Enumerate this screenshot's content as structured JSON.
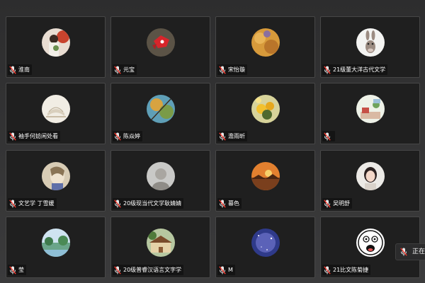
{
  "participants": [
    {
      "name": "淮南",
      "avatar": "woman-with-flowers"
    },
    {
      "name": "元宝",
      "avatar": "red-cartoon-bird"
    },
    {
      "name": "宋怡璇",
      "avatar": "autumn-leaves"
    },
    {
      "name": "21级董大洋古代文学",
      "avatar": "donkey-cartoon"
    },
    {
      "name": "袖手何妨闲处看",
      "avatar": "book-pages"
    },
    {
      "name": "陈焱婷",
      "avatar": "tree-branches"
    },
    {
      "name": "澹雨昕",
      "avatar": "yellow-flowers"
    },
    {
      "name": "",
      "avatar": "bedroom-illustration"
    },
    {
      "name": "文艺学 丁雪媛",
      "avatar": "anime-figure"
    },
    {
      "name": "20级现当代文学耿婧婧",
      "avatar": "blurred-portrait"
    },
    {
      "name": "暮色",
      "avatar": "sunset-landscape"
    },
    {
      "name": "吴明舒",
      "avatar": "girl-portrait"
    },
    {
      "name": "莹",
      "avatar": "lake-scenery"
    },
    {
      "name": "20级普睿汉语言文字学",
      "avatar": "house-with-trees"
    },
    {
      "name": "M",
      "avatar": "starry-sky"
    },
    {
      "name": "21比文陈菊捷",
      "avatar": "surprised-cartoon-face"
    }
  ],
  "speaker_indicator": {
    "label": "正在"
  },
  "colors": {
    "tile_bg": "#1f1f1f",
    "muted_mic": "#ff3b30"
  }
}
